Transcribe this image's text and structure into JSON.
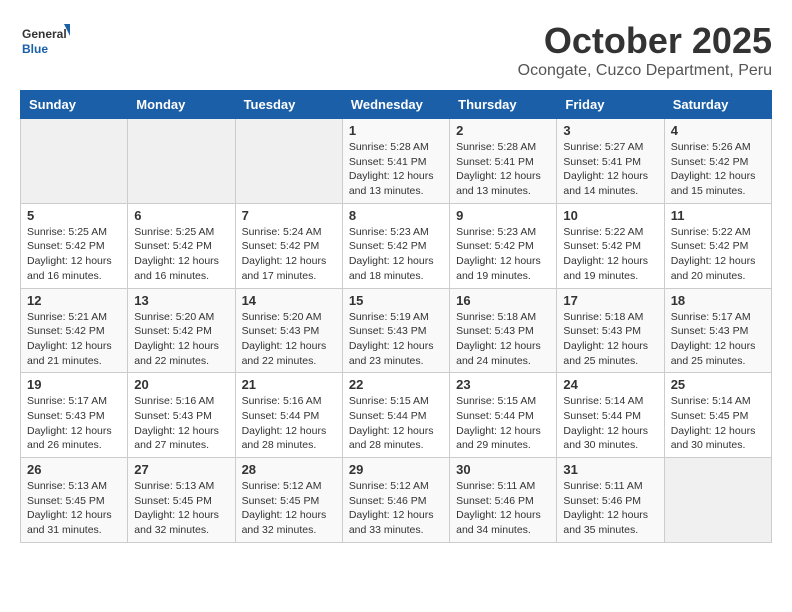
{
  "header": {
    "logo_general": "General",
    "logo_blue": "Blue",
    "month_title": "October 2025",
    "location": "Ocongate, Cuzco Department, Peru"
  },
  "days_of_week": [
    "Sunday",
    "Monday",
    "Tuesday",
    "Wednesday",
    "Thursday",
    "Friday",
    "Saturday"
  ],
  "weeks": [
    [
      {
        "day": "",
        "info": ""
      },
      {
        "day": "",
        "info": ""
      },
      {
        "day": "",
        "info": ""
      },
      {
        "day": "1",
        "info": "Sunrise: 5:28 AM\nSunset: 5:41 PM\nDaylight: 12 hours\nand 13 minutes."
      },
      {
        "day": "2",
        "info": "Sunrise: 5:28 AM\nSunset: 5:41 PM\nDaylight: 12 hours\nand 13 minutes."
      },
      {
        "day": "3",
        "info": "Sunrise: 5:27 AM\nSunset: 5:41 PM\nDaylight: 12 hours\nand 14 minutes."
      },
      {
        "day": "4",
        "info": "Sunrise: 5:26 AM\nSunset: 5:42 PM\nDaylight: 12 hours\nand 15 minutes."
      }
    ],
    [
      {
        "day": "5",
        "info": "Sunrise: 5:25 AM\nSunset: 5:42 PM\nDaylight: 12 hours\nand 16 minutes."
      },
      {
        "day": "6",
        "info": "Sunrise: 5:25 AM\nSunset: 5:42 PM\nDaylight: 12 hours\nand 16 minutes."
      },
      {
        "day": "7",
        "info": "Sunrise: 5:24 AM\nSunset: 5:42 PM\nDaylight: 12 hours\nand 17 minutes."
      },
      {
        "day": "8",
        "info": "Sunrise: 5:23 AM\nSunset: 5:42 PM\nDaylight: 12 hours\nand 18 minutes."
      },
      {
        "day": "9",
        "info": "Sunrise: 5:23 AM\nSunset: 5:42 PM\nDaylight: 12 hours\nand 19 minutes."
      },
      {
        "day": "10",
        "info": "Sunrise: 5:22 AM\nSunset: 5:42 PM\nDaylight: 12 hours\nand 19 minutes."
      },
      {
        "day": "11",
        "info": "Sunrise: 5:22 AM\nSunset: 5:42 PM\nDaylight: 12 hours\nand 20 minutes."
      }
    ],
    [
      {
        "day": "12",
        "info": "Sunrise: 5:21 AM\nSunset: 5:42 PM\nDaylight: 12 hours\nand 21 minutes."
      },
      {
        "day": "13",
        "info": "Sunrise: 5:20 AM\nSunset: 5:42 PM\nDaylight: 12 hours\nand 22 minutes."
      },
      {
        "day": "14",
        "info": "Sunrise: 5:20 AM\nSunset: 5:43 PM\nDaylight: 12 hours\nand 22 minutes."
      },
      {
        "day": "15",
        "info": "Sunrise: 5:19 AM\nSunset: 5:43 PM\nDaylight: 12 hours\nand 23 minutes."
      },
      {
        "day": "16",
        "info": "Sunrise: 5:18 AM\nSunset: 5:43 PM\nDaylight: 12 hours\nand 24 minutes."
      },
      {
        "day": "17",
        "info": "Sunrise: 5:18 AM\nSunset: 5:43 PM\nDaylight: 12 hours\nand 25 minutes."
      },
      {
        "day": "18",
        "info": "Sunrise: 5:17 AM\nSunset: 5:43 PM\nDaylight: 12 hours\nand 25 minutes."
      }
    ],
    [
      {
        "day": "19",
        "info": "Sunrise: 5:17 AM\nSunset: 5:43 PM\nDaylight: 12 hours\nand 26 minutes."
      },
      {
        "day": "20",
        "info": "Sunrise: 5:16 AM\nSunset: 5:43 PM\nDaylight: 12 hours\nand 27 minutes."
      },
      {
        "day": "21",
        "info": "Sunrise: 5:16 AM\nSunset: 5:44 PM\nDaylight: 12 hours\nand 28 minutes."
      },
      {
        "day": "22",
        "info": "Sunrise: 5:15 AM\nSunset: 5:44 PM\nDaylight: 12 hours\nand 28 minutes."
      },
      {
        "day": "23",
        "info": "Sunrise: 5:15 AM\nSunset: 5:44 PM\nDaylight: 12 hours\nand 29 minutes."
      },
      {
        "day": "24",
        "info": "Sunrise: 5:14 AM\nSunset: 5:44 PM\nDaylight: 12 hours\nand 30 minutes."
      },
      {
        "day": "25",
        "info": "Sunrise: 5:14 AM\nSunset: 5:45 PM\nDaylight: 12 hours\nand 30 minutes."
      }
    ],
    [
      {
        "day": "26",
        "info": "Sunrise: 5:13 AM\nSunset: 5:45 PM\nDaylight: 12 hours\nand 31 minutes."
      },
      {
        "day": "27",
        "info": "Sunrise: 5:13 AM\nSunset: 5:45 PM\nDaylight: 12 hours\nand 32 minutes."
      },
      {
        "day": "28",
        "info": "Sunrise: 5:12 AM\nSunset: 5:45 PM\nDaylight: 12 hours\nand 32 minutes."
      },
      {
        "day": "29",
        "info": "Sunrise: 5:12 AM\nSunset: 5:46 PM\nDaylight: 12 hours\nand 33 minutes."
      },
      {
        "day": "30",
        "info": "Sunrise: 5:11 AM\nSunset: 5:46 PM\nDaylight: 12 hours\nand 34 minutes."
      },
      {
        "day": "31",
        "info": "Sunrise: 5:11 AM\nSunset: 5:46 PM\nDaylight: 12 hours\nand 35 minutes."
      },
      {
        "day": "",
        "info": ""
      }
    ]
  ]
}
